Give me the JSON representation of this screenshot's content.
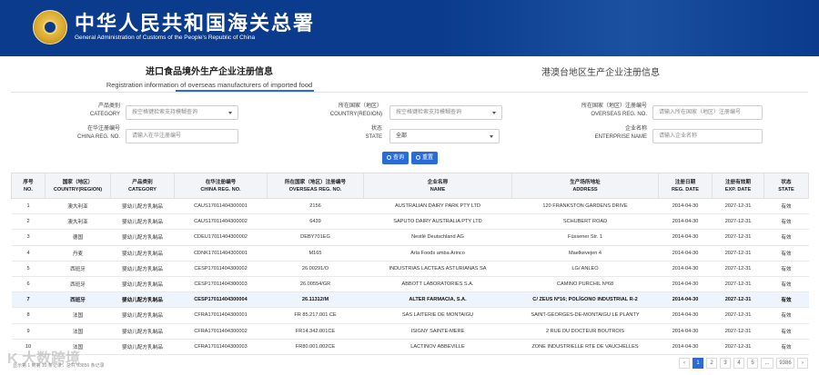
{
  "header": {
    "title": "中华人民共和国海关总署",
    "subtitle": "General Administration of Customs of the People's Republic of China"
  },
  "tabs": {
    "left_cn": "进口食品境外生产企业注册信息",
    "left_en": "Registration information of overseas manufacturers of imported food",
    "right_cn": "港澳台地区生产企业注册信息"
  },
  "filters": {
    "category": {
      "label_cn": "产品类别",
      "label_en": "CATEGORY",
      "placeholder": "按空格键检索支持模糊查询"
    },
    "country": {
      "label_cn": "所在国家（地区）",
      "label_en": "COUNTRY(REGION)",
      "placeholder": "按空格键检索支持模糊查询"
    },
    "overseas_reg": {
      "label_cn": "所在国家（地区）注册编号",
      "label_en": "OVERSEAS REG. NO.",
      "placeholder": "请输入所在国家（地区）注册编号"
    },
    "china_reg": {
      "label_cn": "在华注册编号",
      "label_en": "CHINA REG. NO.",
      "placeholder": "请输入在华注册编号"
    },
    "state": {
      "label_cn": "状态",
      "label_en": "STATE",
      "value": "全部"
    },
    "enterprise": {
      "label_cn": "企业名称",
      "label_en": "ENTERPRISE NAME",
      "placeholder": "请输入企业名称"
    }
  },
  "buttons": {
    "search": "查询",
    "reset": "重置"
  },
  "table": {
    "headers": [
      [
        "序号",
        "NO."
      ],
      [
        "国家（地区）",
        "COUNTRY(REGION)"
      ],
      [
        "产品类别",
        "CATEGORY"
      ],
      [
        "在华注册编号",
        "CHINA REG. NO."
      ],
      [
        "所在国家（地区）注册编号",
        "OVERSEAS REG. NO."
      ],
      [
        "企业名称",
        "NAME"
      ],
      [
        "生产场所地址",
        "ADDRESS"
      ],
      [
        "注册日期",
        "REG. DATE"
      ],
      [
        "注册有效期",
        "EXP. DATE"
      ],
      [
        "状态",
        "STATE"
      ]
    ],
    "rows": [
      [
        "1",
        "澳大利亚",
        "婴幼儿配方乳制品",
        "CAUS17011404300001",
        "2156",
        "AUSTRALIAN DAIRY PARK PTY LTD",
        "120 FRANKSTON GARDENS DRIVE",
        "2014-04-30",
        "2027-12-31",
        "有效"
      ],
      [
        "2",
        "澳大利亚",
        "婴幼儿配方乳制品",
        "CAUS17011404300002",
        "6439",
        "SAPUTO DAIRY AUSTRALIA PTY LTD",
        "SCHUBERT ROAD",
        "2014-04-30",
        "2027-12-31",
        "有效"
      ],
      [
        "3",
        "德国",
        "婴幼儿配方乳制品",
        "CDEU17011404300002",
        "DEBY701EG",
        "Nestlé Deutschland AG",
        "Füssener Str. 1",
        "2014-04-30",
        "2027-12-31",
        "有效"
      ],
      [
        "4",
        "丹麦",
        "婴幼儿配方乳制品",
        "CDNK17011404300001",
        "M165",
        "Arla Foods amba Arinco",
        "Maelkevejen 4",
        "2014-04-30",
        "2027-12-31",
        "有效"
      ],
      [
        "5",
        "西班牙",
        "婴幼儿配方乳制品",
        "CESP17011404300002",
        "26.00291/O",
        "INDUSTRIAS LACTEAS ASTURIANAS SA",
        "LG/ ANLEO",
        "2014-04-30",
        "2027-12-31",
        "有效"
      ],
      [
        "6",
        "西班牙",
        "婴幼儿配方乳制品",
        "CESP17011404300003",
        "26.00554/GR",
        "ABBOTT LABORATORIES S.A.",
        "CAMINO PURCHIL Nº68",
        "2014-04-30",
        "2027-12-31",
        "有效"
      ],
      [
        "7",
        "西班牙",
        "婴幼儿配方乳制品",
        "CESP17011404300004",
        "26.11312/M",
        "ALTER FARMACIA, S.A.",
        "C/ ZEUS Nº16; POLÍGONO INDUSTRIAL R-2",
        "2014-04-30",
        "2027-12-31",
        "有效"
      ],
      [
        "8",
        "法国",
        "婴幼儿配方乳制品",
        "CFRA17011404300001",
        "FR 85.217.001 CE",
        "SAS LAITERIE DE MONTAIGU",
        "SAINT-GEORGES-DE-MONTAIGU LE PLANTY",
        "2014-04-30",
        "2027-12-31",
        "有效"
      ],
      [
        "9",
        "法国",
        "婴幼儿配方乳制品",
        "CFRA17011404300002",
        "FR14.342.001CE",
        "ISIGNY SAINTE-MERE",
        "2 RUE DU DOCTEUR BOUTROIS",
        "2014-04-30",
        "2027-12-31",
        "有效"
      ],
      [
        "10",
        "法国",
        "婴幼儿配方乳制品",
        "CFRA17011404300003",
        "FR80.001.002CE",
        "LACTINOV ABBEVILLE",
        "ZONE INDUSTRIELLE RTE DE VAUCHELLES",
        "2014-04-30",
        "2027-12-31",
        "有效"
      ]
    ],
    "highlight_row": 7
  },
  "pagination": {
    "prev": "‹",
    "pages": [
      "1",
      "2",
      "3",
      "4",
      "5"
    ],
    "ellipsis": "...",
    "last": "9386",
    "next": "›",
    "active": "1"
  },
  "footer_note": "显示第 1 到第 10 条记录，总共 93856 条记录",
  "watermark": "K 大数跨境",
  "colors": {
    "header_bg": "#0a3b8c",
    "accent": "#2a6bd8",
    "highlight_row": "#eef4fd"
  }
}
